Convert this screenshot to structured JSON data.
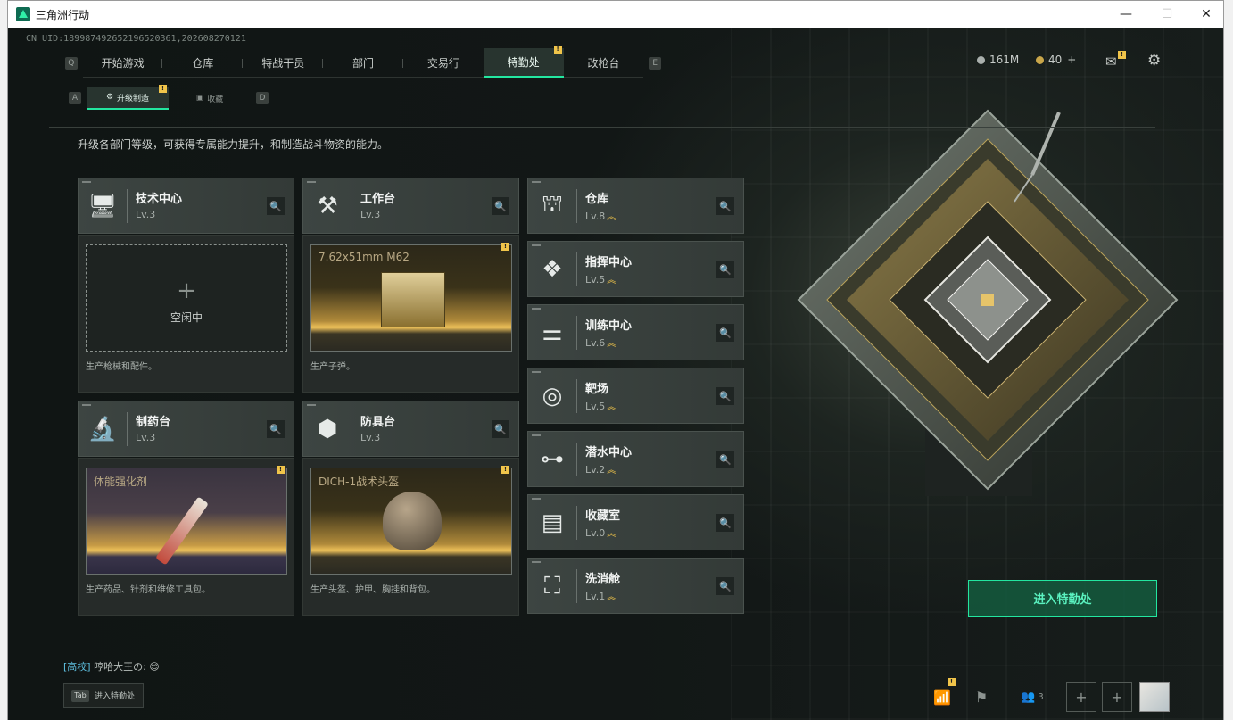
{
  "window": {
    "title": "三角洲行动",
    "minimize": "—",
    "maximize": "☐",
    "close": "✕"
  },
  "uid": "CN UID:189987492652196520361,202608270121",
  "nav": {
    "left_key": "Q",
    "right_key": "E",
    "tabs": [
      "开始游戏",
      "仓库",
      "特战干员",
      "部门",
      "交易行",
      "特勤处",
      "改枪台"
    ]
  },
  "subnav": {
    "left_key": "A",
    "right_key": "D",
    "tabs": [
      "升级制造",
      "收藏"
    ]
  },
  "resources": {
    "currency": "161M",
    "tickets": "40",
    "plus": "+"
  },
  "description": "升级各部门等级，可获得专属能力提升，和制造战斗物资的能力。",
  "production": [
    {
      "name": "技术中心",
      "level": "Lv.3",
      "icon": "computer-icon",
      "slot": "empty",
      "slot_text": "空闲中",
      "footer": "生产枪械和配件。"
    },
    {
      "name": "工作台",
      "level": "Lv.3",
      "icon": "tools-icon",
      "slot": "item",
      "item": "7.62x51mm M62",
      "footer": "生产子弹。"
    },
    {
      "name": "制药台",
      "level": "Lv.3",
      "icon": "microscope-icon",
      "slot": "item",
      "item": "体能强化剂",
      "footer": "生产药品、针剂和维修工具包。"
    },
    {
      "name": "防具台",
      "level": "Lv.3",
      "icon": "cubes-icon",
      "slot": "item",
      "item": "DICH-1战术头盔",
      "footer": "生产头盔、护甲、胸挂和背包。"
    }
  ],
  "departments": [
    {
      "name": "仓库",
      "level": "Lv.8",
      "icon": "warehouse-icon"
    },
    {
      "name": "指挥中心",
      "level": "Lv.5",
      "icon": "command-icon"
    },
    {
      "name": "训练中心",
      "level": "Lv.6",
      "icon": "dumbbell-icon"
    },
    {
      "name": "靶场",
      "level": "Lv.5",
      "icon": "target-icon"
    },
    {
      "name": "潜水中心",
      "level": "Lv.2",
      "icon": "goggles-icon"
    },
    {
      "name": "收藏室",
      "level": "Lv.0",
      "icon": "collection-icon"
    },
    {
      "name": "洗消舱",
      "level": "Lv.1",
      "icon": "decon-icon"
    }
  ],
  "enter_button": "进入特勤处",
  "chat": {
    "channel": "[高校]",
    "message": "哼哈大王の: 😊"
  },
  "tab_hint": {
    "key": "Tab",
    "label": "进入特勤处"
  },
  "bottom": {
    "squad_count": "3"
  },
  "colors": {
    "accent": "#23e6a0",
    "alert": "#f0c44a",
    "panel": "#3d4542"
  }
}
